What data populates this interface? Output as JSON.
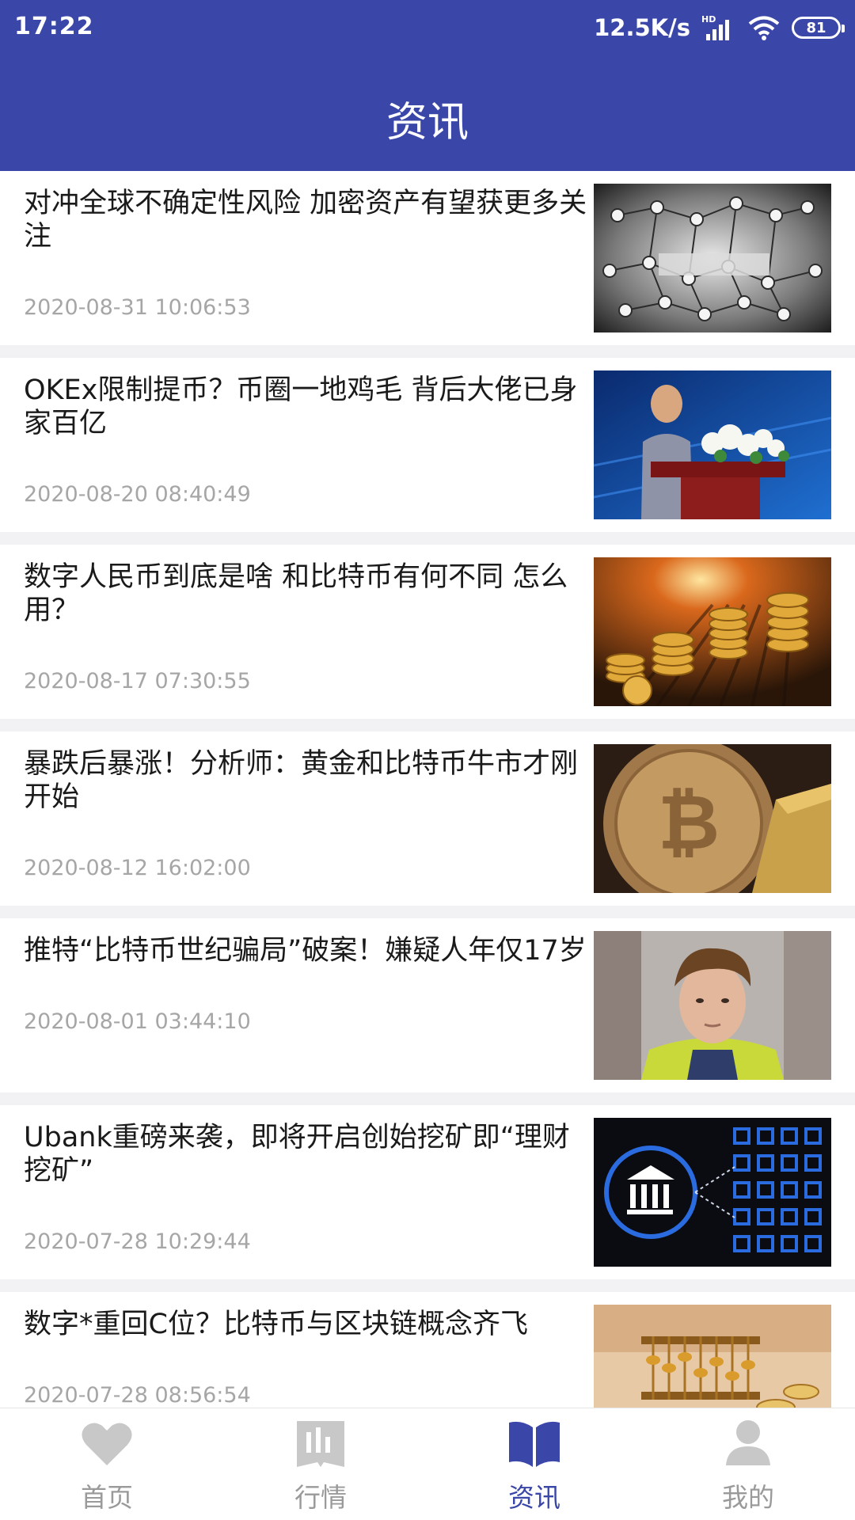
{
  "status_bar": {
    "time": "17:22",
    "network_speed": "12.5K/s",
    "battery_level": "81",
    "icons": [
      "hd-signal-icon",
      "wifi-icon",
      "battery-icon"
    ]
  },
  "header": {
    "title": "资讯"
  },
  "news": [
    {
      "title": "对冲全球不确定性风险 加密资产有望获更多关注",
      "date": "2020-08-31 10:06:53",
      "thumbnail": "blockchain-network-image"
    },
    {
      "title": "OKEx限制提币？币圈一地鸡毛 背后大佬已身家百亿",
      "date": "2020-08-20 08:40:49",
      "thumbnail": "speaker-podium-image"
    },
    {
      "title": "数字人民币到底是啥 和比特币有何不同 怎么用？",
      "date": "2020-08-17 07:30:55",
      "thumbnail": "gold-coin-stacks-image"
    },
    {
      "title": "暴跌后暴涨！分析师：黄金和比特币牛市才刚开始",
      "date": "2020-08-12 16:02:00",
      "thumbnail": "bitcoin-gold-bar-image"
    },
    {
      "title": "推特“比特币世纪骗局”破案！嫌疑人年仅17岁",
      "date": "2020-08-01 03:44:10",
      "thumbnail": "suspect-portrait-image"
    },
    {
      "title": "Ubank重磅来袭，即将开启创始挖矿即“理财挖矿”",
      "date": "2020-07-28 10:29:44",
      "thumbnail": "bank-blockchain-image"
    },
    {
      "title": "数字*重回C位？比特币与区块链概念齐飞",
      "date": "2020-07-28 08:56:54",
      "thumbnail": "abacus-coins-image"
    }
  ],
  "tabs": [
    {
      "label": "首页",
      "icon": "heart-icon",
      "active": false
    },
    {
      "label": "行情",
      "icon": "chart-book-icon",
      "active": false
    },
    {
      "label": "资讯",
      "icon": "open-book-icon",
      "active": true
    },
    {
      "label": "我的",
      "icon": "user-icon",
      "active": false
    }
  ],
  "colors": {
    "primary": "#3a47a9",
    "inactive_tab": "#c8c8c8",
    "date_text": "#a6a6a6"
  }
}
